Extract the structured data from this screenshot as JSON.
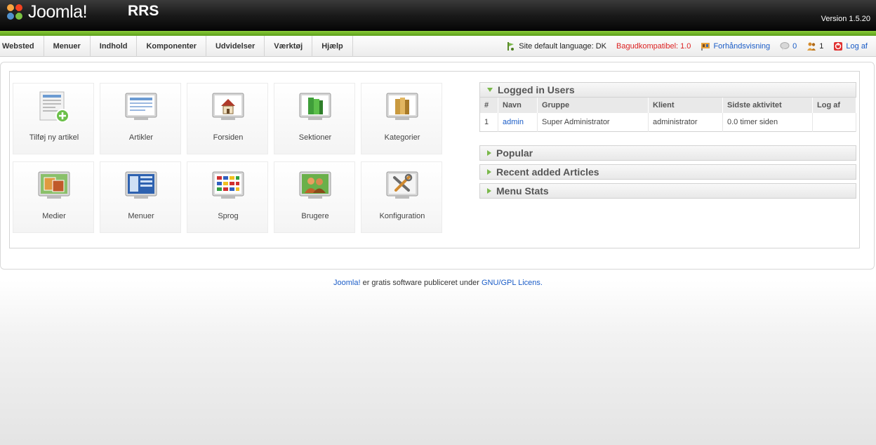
{
  "header": {
    "logo_text": "Joomla!",
    "site_name": "RRS",
    "version": "Version 1.5.20"
  },
  "menu": [
    {
      "label": "Websted"
    },
    {
      "label": "Menuer"
    },
    {
      "label": "Indhold"
    },
    {
      "label": "Komponenter"
    },
    {
      "label": "Udvidelser"
    },
    {
      "label": "Værktøj"
    },
    {
      "label": "Hjælp"
    }
  ],
  "status": {
    "language": "Site default language: DK",
    "compat": "Bagudkompatibel: 1.0",
    "preview": "Forhåndsvisning",
    "messages": "0",
    "users_online": "1",
    "logout": "Log af"
  },
  "cpanel": [
    {
      "label": "Tilføj ny artikel",
      "icon": "add-article-icon"
    },
    {
      "label": "Artikler",
      "icon": "articles-icon"
    },
    {
      "label": "Forsiden",
      "icon": "frontpage-icon"
    },
    {
      "label": "Sektioner",
      "icon": "sections-icon"
    },
    {
      "label": "Kategorier",
      "icon": "categories-icon"
    },
    {
      "label": "Medier",
      "icon": "media-icon"
    },
    {
      "label": "Menuer",
      "icon": "menus-icon"
    },
    {
      "label": "Sprog",
      "icon": "language-icon"
    },
    {
      "label": "Brugere",
      "icon": "users-icon"
    },
    {
      "label": "Konfiguration",
      "icon": "config-icon"
    }
  ],
  "logged_in": {
    "title": "Logged in Users",
    "columns": [
      "#",
      "Navn",
      "Gruppe",
      "Klient",
      "Sidste aktivitet",
      "Log af"
    ],
    "rows": [
      {
        "num": "1",
        "name": "admin",
        "group": "Super Administrator",
        "client": "administrator",
        "activity": "0.0 timer siden",
        "logout": ""
      }
    ]
  },
  "panels": {
    "popular": "Popular",
    "recent": "Recent added Articles",
    "menu_stats": "Menu Stats"
  },
  "footer": {
    "joomla_link": "Joomla!",
    "text": " er gratis software publiceret under ",
    "license_link": "GNU/GPL Licens",
    "period": "."
  },
  "colors": {
    "accent_green": "#7ab84a",
    "link_blue": "#1a5cc7",
    "warning_red": "#d22222"
  }
}
